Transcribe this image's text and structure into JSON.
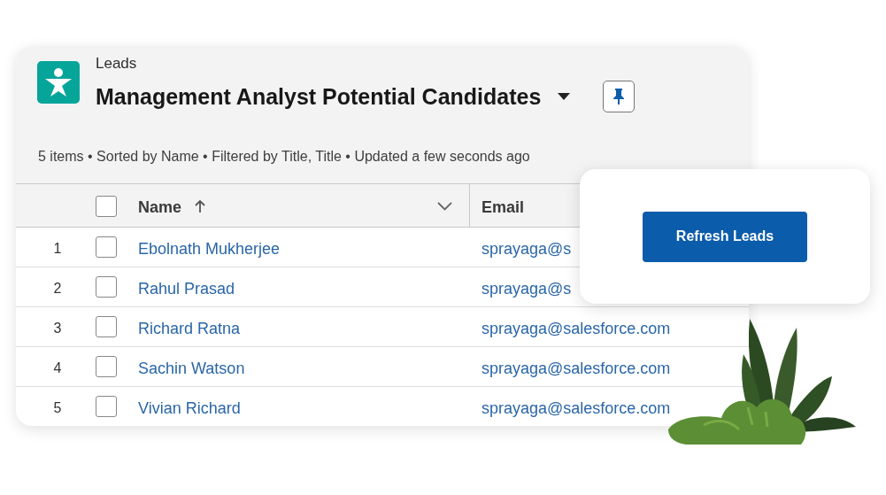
{
  "list_view": {
    "object_label": "Leads",
    "title": "Management Analyst Potential Candidates",
    "status_text": "5 items • Sorted by Name • Filtered by Title, Title • Updated a few seconds ago"
  },
  "table": {
    "select_all": {
      "checked": false
    },
    "columns": [
      {
        "label": "Name",
        "sorted": true
      },
      {
        "label": "Email"
      }
    ],
    "rows": [
      {
        "number": "1",
        "checked": false,
        "name": "Ebolnath Mukherjee",
        "email": "sprayaga@s"
      },
      {
        "number": "2",
        "checked": false,
        "name": "Rahul Prasad",
        "email": "sprayaga@s"
      },
      {
        "number": "3",
        "checked": false,
        "name": "Richard Ratna",
        "email": "sprayaga@salesforce.com"
      },
      {
        "number": "4",
        "checked": false,
        "name": "Sachin Watson",
        "email": "sprayaga@salesforce.com"
      },
      {
        "number": "5",
        "checked": false,
        "name": "Vivian Richard",
        "email": "sprayaga@salesforce.com"
      }
    ]
  },
  "popup": {
    "button": "Refresh Leads"
  }
}
